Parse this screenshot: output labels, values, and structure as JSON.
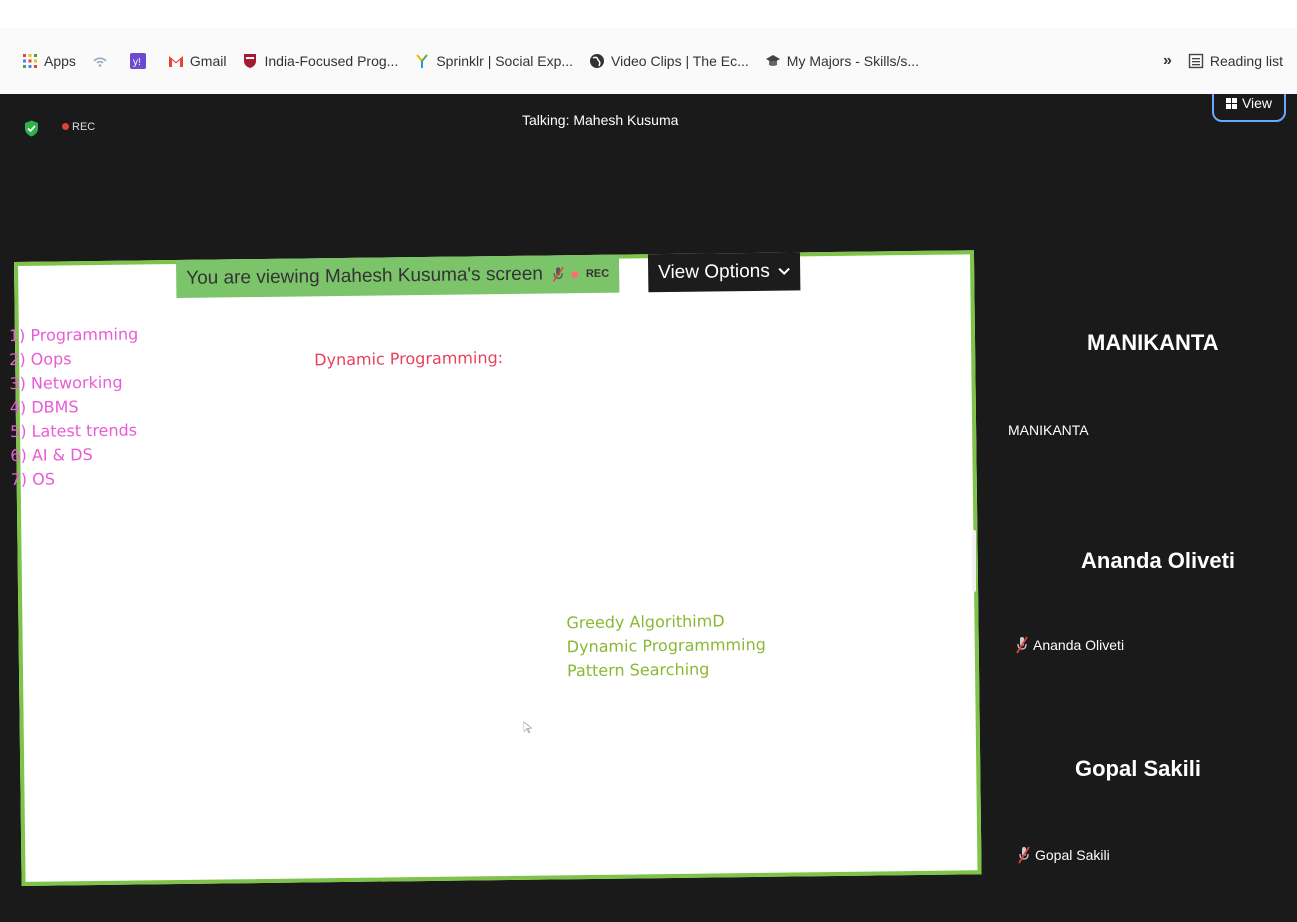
{
  "bookmarks": {
    "items": [
      {
        "label": "Apps",
        "icon": "apps-grid-icon"
      },
      {
        "label": "",
        "icon": "wifi-icon"
      },
      {
        "label": "",
        "icon": "yahoo-icon"
      },
      {
        "label": "Gmail",
        "icon": "gmail-icon"
      },
      {
        "label": "India-Focused Prog...",
        "icon": "harvard-shield-icon"
      },
      {
        "label": "Sprinklr | Social Exp...",
        "icon": "sprinklr-icon"
      },
      {
        "label": "Video Clips | The Ec...",
        "icon": "globe-icon"
      },
      {
        "label": "My Majors - Skills/s...",
        "icon": "graduation-cap-icon"
      }
    ],
    "overflow": "»",
    "reading_list": "Reading list"
  },
  "meeting": {
    "rec_label": "REC",
    "talking": "Talking: Mahesh Kusuma",
    "view_label": "View",
    "accent_color": "#7fc34b"
  },
  "share": {
    "banner_text": "You are viewing Mahesh Kusuma's screen",
    "banner_rec": "REC",
    "view_options": "View Options",
    "topics": [
      "1) Programming",
      "2) Oops",
      "3) Networking",
      "4) DBMS",
      "5) Latest trends",
      "6) AI & DS",
      "7) OS"
    ],
    "dp_title": "Dynamic Programming:",
    "algorithms": [
      "Greedy AlgorithimD",
      "Dynamic Programmming",
      "Pattern Searching"
    ]
  },
  "participants": [
    {
      "tile_name": "MANIKANTA",
      "label": "MANIKANTA",
      "muted": false
    },
    {
      "tile_name": "Ananda Oliveti",
      "label": "Ananda Oliveti",
      "muted": true
    },
    {
      "tile_name": "Gopal Sakili",
      "label": "Gopal Sakili",
      "muted": true
    }
  ]
}
